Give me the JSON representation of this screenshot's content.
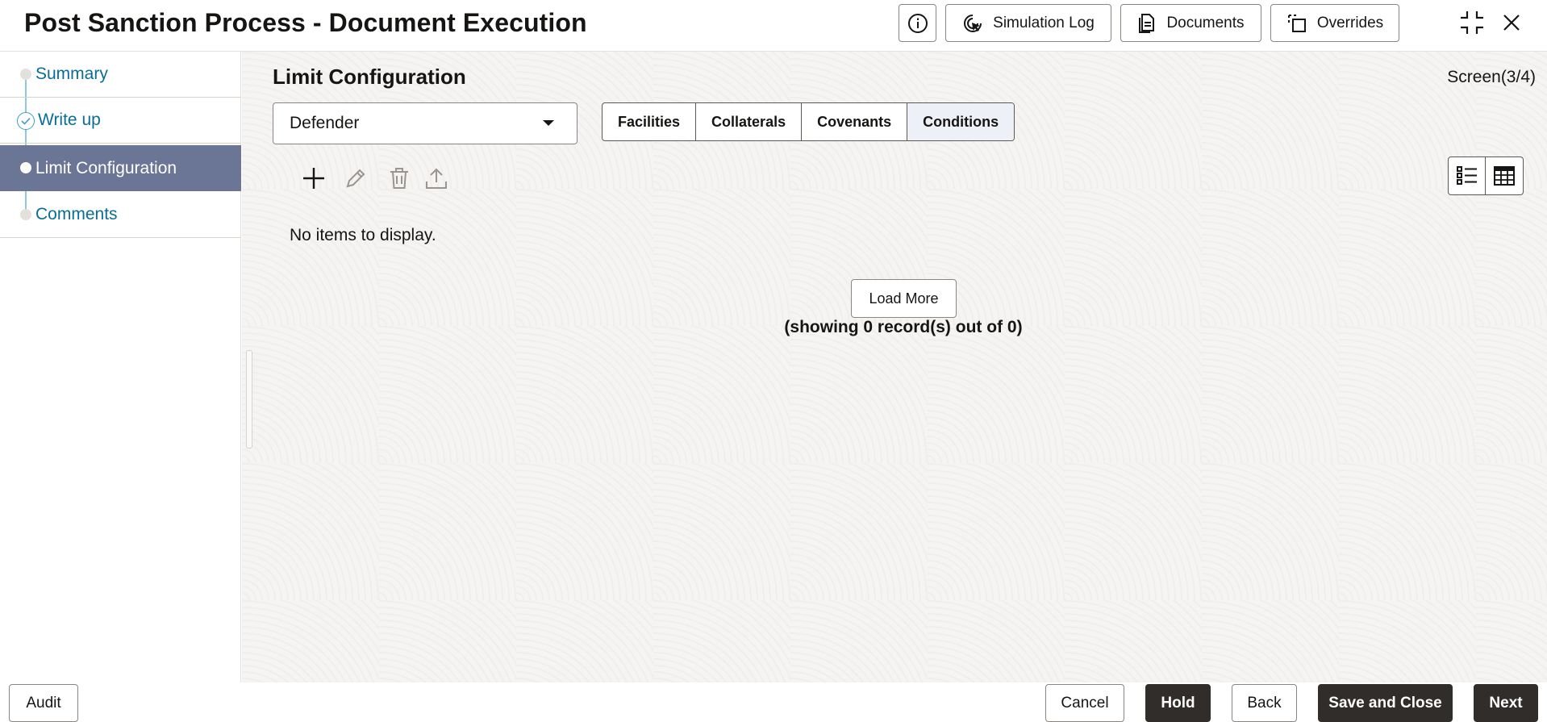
{
  "header": {
    "title": "Post Sanction Process - Document Execution",
    "buttons": {
      "simulation_log": "Simulation Log",
      "documents": "Documents",
      "overrides": "Overrides"
    }
  },
  "sidebar": {
    "items": [
      {
        "label": "Summary",
        "state": "pending"
      },
      {
        "label": "Write up",
        "state": "done"
      },
      {
        "label": "Limit Configuration",
        "state": "active"
      },
      {
        "label": "Comments",
        "state": "pending"
      }
    ]
  },
  "main": {
    "section_title": "Limit Configuration",
    "screen_indicator": "Screen(3/4)",
    "select": {
      "value": "Defender"
    },
    "tabs": [
      {
        "label": "Facilities"
      },
      {
        "label": "Collaterals"
      },
      {
        "label": "Covenants"
      },
      {
        "label": "Conditions",
        "active": true
      }
    ],
    "toolbar": [
      "add-icon",
      "edit-icon",
      "delete-icon",
      "upload-icon"
    ],
    "empty_message": "No items to display.",
    "load_more_label": "Load More",
    "record_count": "(showing 0 record(s) out of 0)"
  },
  "footer": {
    "audit": "Audit",
    "cancel": "Cancel",
    "hold": "Hold",
    "back": "Back",
    "save_close": "Save and Close",
    "next": "Next"
  },
  "colors": {
    "active_step_bg": "#6b7595",
    "link_text": "#086e96",
    "dark_button": "#312d2a"
  }
}
